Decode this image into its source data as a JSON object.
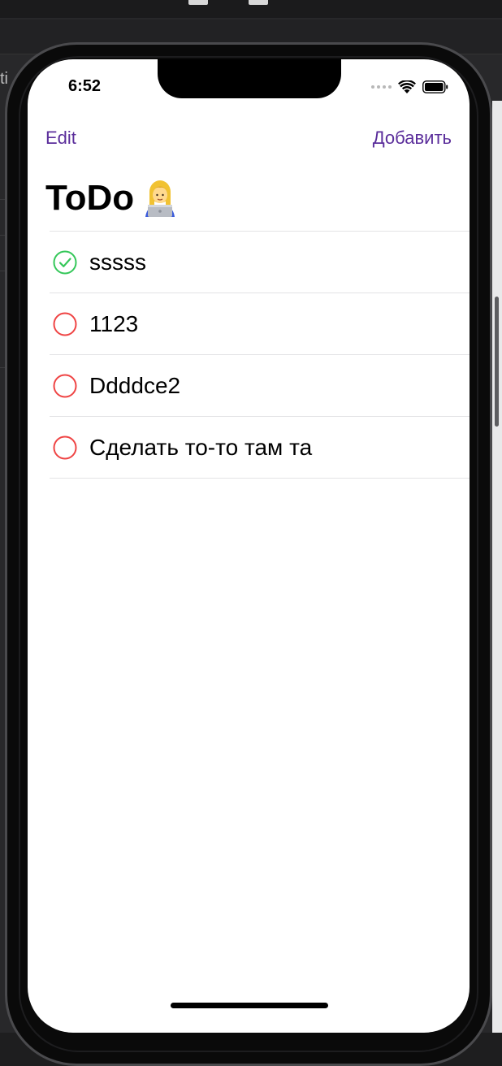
{
  "status_bar": {
    "time": "6:52"
  },
  "nav": {
    "edit_label": "Edit",
    "add_label": "Добавить"
  },
  "page": {
    "title": "ToDo",
    "title_emoji": "woman-technologist-icon"
  },
  "todos": [
    {
      "label": "sssss",
      "done": true
    },
    {
      "label": "1123",
      "done": false
    },
    {
      "label": "Ddddce2",
      "done": false
    },
    {
      "label": "Сделать то-то там та",
      "done": false
    }
  ],
  "colors": {
    "accent": "#5b2e9b",
    "done": "#34c759",
    "pending": "#ef4444"
  },
  "backdrop": {
    "side_text": "ti"
  }
}
